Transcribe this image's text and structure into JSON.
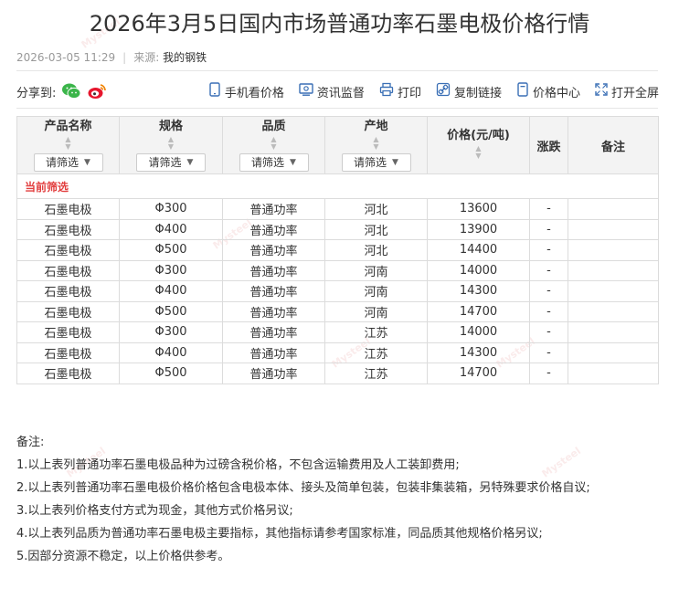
{
  "title": "2026年3月5日国内市场普通功率石墨电极价格行情",
  "meta": {
    "datetime": "2026-03-05 11:29",
    "source_label": "来源:",
    "source_value": "我的钢铁"
  },
  "share": {
    "label": "分享到:",
    "icons": [
      "wechat-icon",
      "weibo-icon"
    ]
  },
  "tools": [
    {
      "icon": "mobile-icon",
      "label": "手机看价格"
    },
    {
      "icon": "monitor-icon",
      "label": "资讯监督"
    },
    {
      "icon": "printer-icon",
      "label": "打印"
    },
    {
      "icon": "link-icon",
      "label": "复制链接"
    },
    {
      "icon": "price-center-icon",
      "label": "价格中心"
    },
    {
      "icon": "fullscreen-icon",
      "label": "打开全屏"
    }
  ],
  "table": {
    "headers": [
      "产品名称",
      "规格",
      "品质",
      "产地",
      "价格(元/吨)",
      "涨跌",
      "备注"
    ],
    "filter_label": "请筛选",
    "current_filter_label": "当前筛选",
    "rows": [
      [
        "石墨电极",
        "Φ300",
        "普通功率",
        "河北",
        "13600",
        "-",
        ""
      ],
      [
        "石墨电极",
        "Φ400",
        "普通功率",
        "河北",
        "13900",
        "-",
        ""
      ],
      [
        "石墨电极",
        "Φ500",
        "普通功率",
        "河北",
        "14400",
        "-",
        ""
      ],
      [
        "石墨电极",
        "Φ300",
        "普通功率",
        "河南",
        "14000",
        "-",
        ""
      ],
      [
        "石墨电极",
        "Φ400",
        "普通功率",
        "河南",
        "14300",
        "-",
        ""
      ],
      [
        "石墨电极",
        "Φ500",
        "普通功率",
        "河南",
        "14700",
        "-",
        ""
      ],
      [
        "石墨电极",
        "Φ300",
        "普通功率",
        "江苏",
        "14000",
        "-",
        ""
      ],
      [
        "石墨电极",
        "Φ400",
        "普通功率",
        "江苏",
        "14300",
        "-",
        ""
      ],
      [
        "石墨电极",
        "Φ500",
        "普通功率",
        "江苏",
        "14700",
        "-",
        ""
      ]
    ]
  },
  "notes": {
    "heading": "备注:",
    "items": [
      "1.以上表列普通功率石墨电极品种为过磅含税价格，不包含运输费用及人工装卸费用;",
      "2.以上表列普通功率石墨电极价格价格包含电极本体、接头及简单包装，包装非集装箱，另特殊要求价格自议;",
      "3.以上表列价格支付方式为现金，其他方式价格另议;",
      "4.以上表列品质为普通功率石墨电极主要指标，其他指标请参考国家标准，同品质其他规格价格另议;",
      "5.因部分资源不稳定，以上价格供参考。"
    ]
  },
  "colors": {
    "current_filter": "#e23f3f",
    "header_bg": "#f3f3f3",
    "border": "#dcdcdc",
    "icon_blue": "#3a6fb5"
  }
}
